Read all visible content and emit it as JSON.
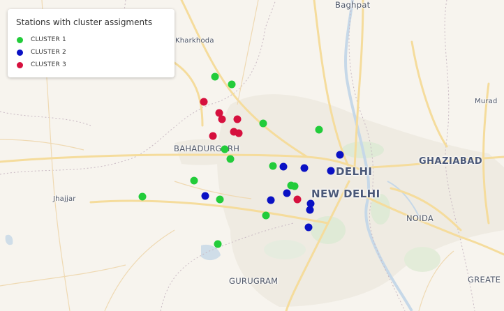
{
  "legend": {
    "title": "Stations with cluster assigments",
    "items": [
      {
        "label": "CLUSTER 1",
        "color": "#22cc3a"
      },
      {
        "label": "CLUSTER 2",
        "color": "#0a11c4"
      },
      {
        "label": "CLUSTER 3",
        "color": "#d6103e"
      }
    ]
  },
  "places": {
    "baghpat": "Baghpat",
    "kharkhoda": "Kharkhoda",
    "bahadurgarh": "BAHADURGARH",
    "delhi": "DELHI",
    "new_delhi": "NEW DELHI",
    "ghaziabad": "GHAZIABAD",
    "noida": "NOIDA",
    "jhajjar": "Jhajjar",
    "gurugram": "GURUGRAM",
    "muradnagar": "Murad",
    "greater_noida": "GREATE"
  },
  "stations": [
    {
      "cluster": 1,
      "lon": 77.103,
      "lat": 28.77
    },
    {
      "cluster": 1,
      "lon": 77.127,
      "lat": 28.76
    },
    {
      "cluster": 1,
      "lon": 77.172,
      "lat": 28.709
    },
    {
      "cluster": 1,
      "lon": 77.251,
      "lat": 28.7
    },
    {
      "cluster": 1,
      "lon": 77.117,
      "lat": 28.675
    },
    {
      "cluster": 1,
      "lon": 77.125,
      "lat": 28.662
    },
    {
      "cluster": 1,
      "lon": 77.186,
      "lat": 28.653
    },
    {
      "cluster": 1,
      "lon": 77.073,
      "lat": 28.633
    },
    {
      "cluster": 1,
      "lon": 77.212,
      "lat": 28.627
    },
    {
      "cluster": 1,
      "lon": 76.999,
      "lat": 28.612
    },
    {
      "cluster": 1,
      "lon": 77.11,
      "lat": 28.609
    },
    {
      "cluster": 1,
      "lon": 77.176,
      "lat": 28.588
    },
    {
      "cluster": 1,
      "lon": 77.107,
      "lat": 28.55
    },
    {
      "cluster": 1,
      "lon": 77.217,
      "lat": 28.626
    },
    {
      "cluster": 2,
      "lon": 77.281,
      "lat": 28.667
    },
    {
      "cluster": 2,
      "lon": 77.201,
      "lat": 28.652
    },
    {
      "cluster": 2,
      "lon": 77.231,
      "lat": 28.65
    },
    {
      "cluster": 2,
      "lon": 77.268,
      "lat": 28.646
    },
    {
      "cluster": 2,
      "lon": 77.206,
      "lat": 28.617
    },
    {
      "cluster": 2,
      "lon": 77.089,
      "lat": 28.613
    },
    {
      "cluster": 2,
      "lon": 77.183,
      "lat": 28.608
    },
    {
      "cluster": 2,
      "lon": 77.24,
      "lat": 28.603
    },
    {
      "cluster": 2,
      "lon": 77.239,
      "lat": 28.595
    },
    {
      "cluster": 2,
      "lon": 77.237,
      "lat": 28.572
    },
    {
      "cluster": 3,
      "lon": 77.087,
      "lat": 28.737
    },
    {
      "cluster": 3,
      "lon": 77.109,
      "lat": 28.722
    },
    {
      "cluster": 3,
      "lon": 77.113,
      "lat": 28.714
    },
    {
      "cluster": 3,
      "lon": 77.135,
      "lat": 28.714
    },
    {
      "cluster": 3,
      "lon": 77.13,
      "lat": 28.698
    },
    {
      "cluster": 3,
      "lon": 77.137,
      "lat": 28.696
    },
    {
      "cluster": 3,
      "lon": 77.1,
      "lat": 28.692
    },
    {
      "cluster": 3,
      "lon": 77.221,
      "lat": 28.609
    }
  ]
}
